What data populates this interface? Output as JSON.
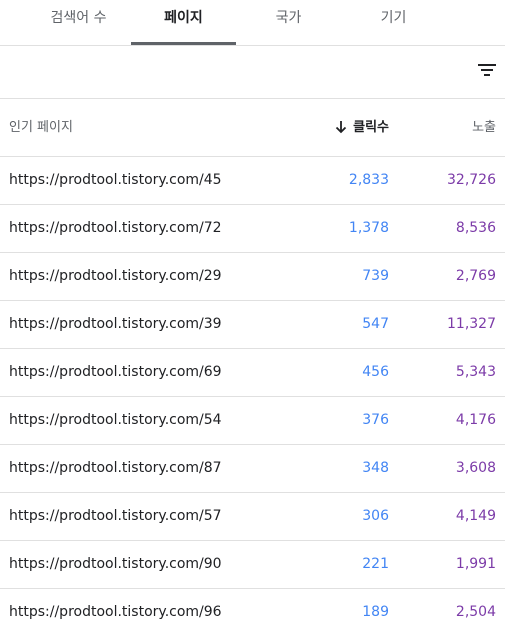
{
  "tabs": [
    {
      "label": "검색어 수",
      "active": false
    },
    {
      "label": "페이지",
      "active": true
    },
    {
      "label": "국가",
      "active": false
    },
    {
      "label": "기기",
      "active": false
    }
  ],
  "toolbar": {
    "filter_icon": "filter-list-icon"
  },
  "table": {
    "headers": {
      "page": "인기 페이지",
      "clicks": "클릭수",
      "impressions": "노출"
    },
    "sort": {
      "column": "clicks",
      "direction": "descending",
      "icon": "arrow-down-icon"
    },
    "rows": [
      {
        "url": "https://prodtool.tistory.com/45",
        "clicks": "2,833",
        "impressions": "32,726"
      },
      {
        "url": "https://prodtool.tistory.com/72",
        "clicks": "1,378",
        "impressions": "8,536"
      },
      {
        "url": "https://prodtool.tistory.com/29",
        "clicks": "739",
        "impressions": "2,769"
      },
      {
        "url": "https://prodtool.tistory.com/39",
        "clicks": "547",
        "impressions": "11,327"
      },
      {
        "url": "https://prodtool.tistory.com/69",
        "clicks": "456",
        "impressions": "5,343"
      },
      {
        "url": "https://prodtool.tistory.com/54",
        "clicks": "376",
        "impressions": "4,176"
      },
      {
        "url": "https://prodtool.tistory.com/87",
        "clicks": "348",
        "impressions": "3,608"
      },
      {
        "url": "https://prodtool.tistory.com/57",
        "clicks": "306",
        "impressions": "4,149"
      },
      {
        "url": "https://prodtool.tistory.com/90",
        "clicks": "221",
        "impressions": "1,991"
      },
      {
        "url": "https://prodtool.tistory.com/96",
        "clicks": "189",
        "impressions": "2,504"
      }
    ]
  },
  "colors": {
    "clicks": "#4285f4",
    "impressions": "#7c3ba8",
    "active_tab_underline": "#5f6368"
  }
}
